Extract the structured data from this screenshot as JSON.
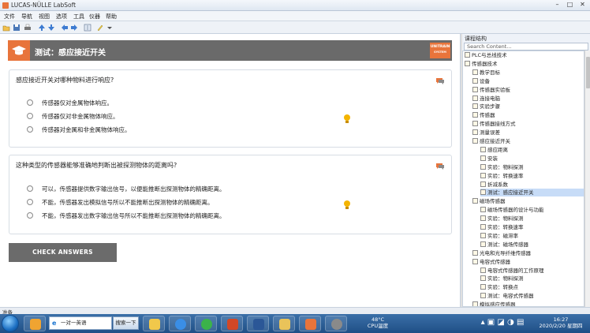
{
  "window": {
    "title": "LUCAS-NÜLLE LabSoft"
  },
  "menu": [
    "文件",
    "导航",
    "视图",
    "选项",
    "工具",
    "仪器",
    "帮助"
  ],
  "lesson": {
    "title": "测试：感应接近开关",
    "logo_top": "UNITRAIN",
    "logo_bottom": "SYSTEM"
  },
  "questions": [
    {
      "text": "感应接近开关对哪种物料进行响应?",
      "options": [
        "传感器仅对金属物体响应。",
        "传感器仅对非金属物体响应。",
        "传感器对金属和非金属物体响应。"
      ]
    },
    {
      "text": "这种类型的传感器能够准确地判断出被探测物体的距离吗?",
      "options": [
        "可以，传感器提供数字输出信号，以便能推断出探测物体的精确距离。",
        "不能，传感器发出模拟信号所以不能推断出探测物体的精确距离。",
        "不能，传感器发出数字输出信号所以不能推断出探测物体的精确距离。"
      ]
    }
  ],
  "check_button": "CHECK ANSWERS",
  "panel": {
    "title": "课程结构",
    "search_placeholder": "Search Content...",
    "tree": [
      {
        "label": "PLC与总线技术",
        "level": 0
      },
      {
        "label": "传感器技术",
        "level": 0
      },
      {
        "label": "教学目标",
        "level": 1
      },
      {
        "label": "设备",
        "level": 1
      },
      {
        "label": "传感器实验板",
        "level": 1
      },
      {
        "label": "连接电脑",
        "level": 1
      },
      {
        "label": "实验步骤",
        "level": 1
      },
      {
        "label": "传感器",
        "level": 1
      },
      {
        "label": "传感器接线方式",
        "level": 1
      },
      {
        "label": "测量误差",
        "level": 1
      },
      {
        "label": "感应接近开关",
        "level": 1
      },
      {
        "label": "感应距离",
        "level": 2
      },
      {
        "label": "安装",
        "level": 2
      },
      {
        "label": "实验：物料探测",
        "level": 2
      },
      {
        "label": "实验：转换速率",
        "level": 2
      },
      {
        "label": "折减系数",
        "level": 2
      },
      {
        "label": "测试：感应接近开关",
        "level": 2,
        "selected": true
      },
      {
        "label": "磁场传感器",
        "level": 1
      },
      {
        "label": "磁场传感器的设计与功能",
        "level": 2
      },
      {
        "label": "实验：物料探测",
        "level": 2
      },
      {
        "label": "实验：转换速率",
        "level": 2
      },
      {
        "label": "实验：磁滞率",
        "level": 2
      },
      {
        "label": "测试：磁场传感器",
        "level": 2
      },
      {
        "label": "光电和光导纤维传感器",
        "level": 1
      },
      {
        "label": "电容式传感器",
        "level": 1
      },
      {
        "label": "电容式传感器的工作原理",
        "level": 2
      },
      {
        "label": "实验：物料探测",
        "level": 2
      },
      {
        "label": "实验：转换点",
        "level": 2
      },
      {
        "label": "测试：电容式传感器",
        "level": 2
      },
      {
        "label": "模拟感应传感器",
        "level": 1
      }
    ]
  },
  "status": {
    "text": "准备"
  },
  "taskbar": {
    "search_value": "一对一英语",
    "search_button": "搜索一下",
    "cpu_temp": "48°C",
    "cpu_label": "CPU温度",
    "time": "16:27",
    "date": "2020/2/20 星期四"
  },
  "colors": {
    "accent": "#e8743b",
    "banner": "#6a6a6a",
    "button": "#6b6b6b",
    "selection": "#c7dcf7"
  }
}
